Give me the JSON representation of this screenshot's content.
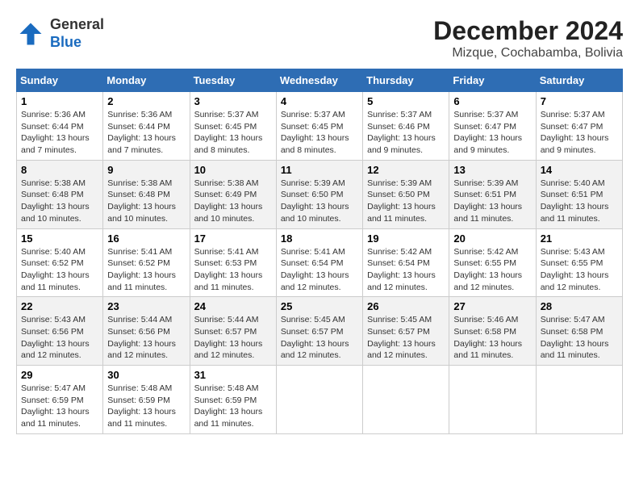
{
  "logo": {
    "text_general": "General",
    "text_blue": "Blue"
  },
  "title": "December 2024",
  "subtitle": "Mizque, Cochabamba, Bolivia",
  "days_of_week": [
    "Sunday",
    "Monday",
    "Tuesday",
    "Wednesday",
    "Thursday",
    "Friday",
    "Saturday"
  ],
  "weeks": [
    [
      {
        "day": 1,
        "sunrise": "5:36 AM",
        "sunset": "6:44 PM",
        "daylight": "13 hours and 7 minutes."
      },
      {
        "day": 2,
        "sunrise": "5:36 AM",
        "sunset": "6:44 PM",
        "daylight": "13 hours and 7 minutes."
      },
      {
        "day": 3,
        "sunrise": "5:37 AM",
        "sunset": "6:45 PM",
        "daylight": "13 hours and 8 minutes."
      },
      {
        "day": 4,
        "sunrise": "5:37 AM",
        "sunset": "6:45 PM",
        "daylight": "13 hours and 8 minutes."
      },
      {
        "day": 5,
        "sunrise": "5:37 AM",
        "sunset": "6:46 PM",
        "daylight": "13 hours and 9 minutes."
      },
      {
        "day": 6,
        "sunrise": "5:37 AM",
        "sunset": "6:47 PM",
        "daylight": "13 hours and 9 minutes."
      },
      {
        "day": 7,
        "sunrise": "5:37 AM",
        "sunset": "6:47 PM",
        "daylight": "13 hours and 9 minutes."
      }
    ],
    [
      {
        "day": 8,
        "sunrise": "5:38 AM",
        "sunset": "6:48 PM",
        "daylight": "13 hours and 10 minutes."
      },
      {
        "day": 9,
        "sunrise": "5:38 AM",
        "sunset": "6:48 PM",
        "daylight": "13 hours and 10 minutes."
      },
      {
        "day": 10,
        "sunrise": "5:38 AM",
        "sunset": "6:49 PM",
        "daylight": "13 hours and 10 minutes."
      },
      {
        "day": 11,
        "sunrise": "5:39 AM",
        "sunset": "6:50 PM",
        "daylight": "13 hours and 10 minutes."
      },
      {
        "day": 12,
        "sunrise": "5:39 AM",
        "sunset": "6:50 PM",
        "daylight": "13 hours and 11 minutes."
      },
      {
        "day": 13,
        "sunrise": "5:39 AM",
        "sunset": "6:51 PM",
        "daylight": "13 hours and 11 minutes."
      },
      {
        "day": 14,
        "sunrise": "5:40 AM",
        "sunset": "6:51 PM",
        "daylight": "13 hours and 11 minutes."
      }
    ],
    [
      {
        "day": 15,
        "sunrise": "5:40 AM",
        "sunset": "6:52 PM",
        "daylight": "13 hours and 11 minutes."
      },
      {
        "day": 16,
        "sunrise": "5:41 AM",
        "sunset": "6:52 PM",
        "daylight": "13 hours and 11 minutes."
      },
      {
        "day": 17,
        "sunrise": "5:41 AM",
        "sunset": "6:53 PM",
        "daylight": "13 hours and 11 minutes."
      },
      {
        "day": 18,
        "sunrise": "5:41 AM",
        "sunset": "6:54 PM",
        "daylight": "13 hours and 12 minutes."
      },
      {
        "day": 19,
        "sunrise": "5:42 AM",
        "sunset": "6:54 PM",
        "daylight": "13 hours and 12 minutes."
      },
      {
        "day": 20,
        "sunrise": "5:42 AM",
        "sunset": "6:55 PM",
        "daylight": "13 hours and 12 minutes."
      },
      {
        "day": 21,
        "sunrise": "5:43 AM",
        "sunset": "6:55 PM",
        "daylight": "13 hours and 12 minutes."
      }
    ],
    [
      {
        "day": 22,
        "sunrise": "5:43 AM",
        "sunset": "6:56 PM",
        "daylight": "13 hours and 12 minutes."
      },
      {
        "day": 23,
        "sunrise": "5:44 AM",
        "sunset": "6:56 PM",
        "daylight": "13 hours and 12 minutes."
      },
      {
        "day": 24,
        "sunrise": "5:44 AM",
        "sunset": "6:57 PM",
        "daylight": "13 hours and 12 minutes."
      },
      {
        "day": 25,
        "sunrise": "5:45 AM",
        "sunset": "6:57 PM",
        "daylight": "13 hours and 12 minutes."
      },
      {
        "day": 26,
        "sunrise": "5:45 AM",
        "sunset": "6:57 PM",
        "daylight": "13 hours and 12 minutes."
      },
      {
        "day": 27,
        "sunrise": "5:46 AM",
        "sunset": "6:58 PM",
        "daylight": "13 hours and 11 minutes."
      },
      {
        "day": 28,
        "sunrise": "5:47 AM",
        "sunset": "6:58 PM",
        "daylight": "13 hours and 11 minutes."
      }
    ],
    [
      {
        "day": 29,
        "sunrise": "5:47 AM",
        "sunset": "6:59 PM",
        "daylight": "13 hours and 11 minutes."
      },
      {
        "day": 30,
        "sunrise": "5:48 AM",
        "sunset": "6:59 PM",
        "daylight": "13 hours and 11 minutes."
      },
      {
        "day": 31,
        "sunrise": "5:48 AM",
        "sunset": "6:59 PM",
        "daylight": "13 hours and 11 minutes."
      },
      null,
      null,
      null,
      null
    ]
  ]
}
